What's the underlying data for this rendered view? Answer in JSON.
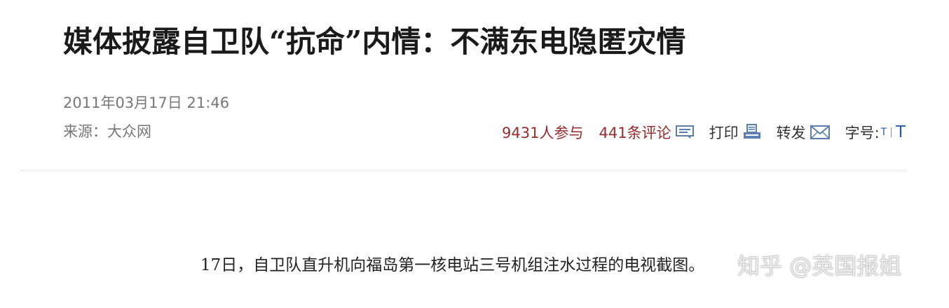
{
  "article": {
    "title": "媒体披露自卫队“抗命”内情：不满东电隐匿灾情",
    "date": "2011年03月17日 21:46",
    "source": "来源：大众网"
  },
  "toolbar": {
    "participants": "9431人参与",
    "comments": "441条评论",
    "print": "打印",
    "share": "转发",
    "font_size_label": "字号:",
    "font_small": "T",
    "font_separator": "|",
    "font_large": "T",
    "accent_color": "#9b2a2e",
    "link_color": "#2a5aa8",
    "comment_icon": "comment-icon",
    "print_icon": "print-icon",
    "share_icon": "mail-icon"
  },
  "body": {
    "caption": "17日，自卫队直升机向福岛第一核电站三号机组注水过程的电视截图。"
  },
  "watermark": {
    "text": "知乎 @英国报姐"
  }
}
